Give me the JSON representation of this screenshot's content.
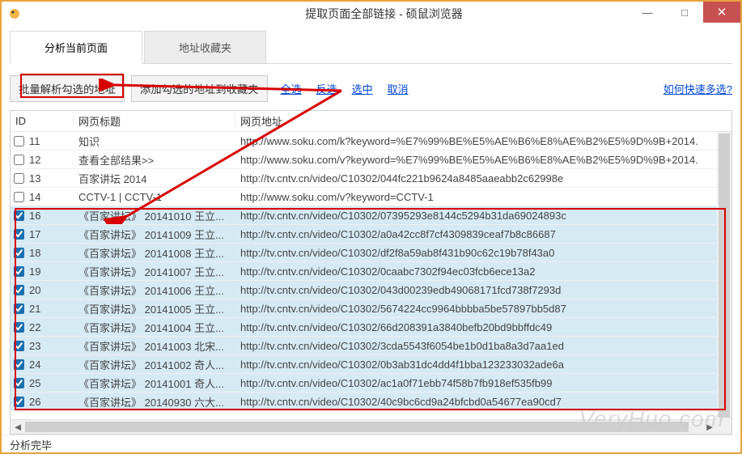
{
  "window": {
    "title": "提取页面全部链接 - 硕鼠浏览器"
  },
  "tabs": {
    "active": "分析当前页面",
    "inactive": "地址收藏夹"
  },
  "toolbar": {
    "batch": "批量解析勾选的地址",
    "add": "添加勾选的地址到收藏夹",
    "selectAll": "全选",
    "invert": "反选",
    "selectChecked": "选中",
    "cancel": "取消",
    "help": "如何快速多选?"
  },
  "columns": {
    "id": "ID",
    "title": "网页标题",
    "url": "网页地址"
  },
  "rows": [
    {
      "id": "11",
      "checked": false,
      "sel": false,
      "title": "知识",
      "url": "http://www.soku.com/k?keyword=%E7%99%BE%E5%AE%B6%E8%AE%B2%E5%9D%9B+2014."
    },
    {
      "id": "12",
      "checked": false,
      "sel": false,
      "title": "查看全部结果&gt;&gt;",
      "url": "http://www.soku.com/v?keyword=%E7%99%BE%E5%AE%B6%E8%AE%B2%E5%9D%9B+2014."
    },
    {
      "id": "13",
      "checked": false,
      "sel": false,
      "title": "百家讲坛 2014",
      "url": "http://tv.cntv.cn/video/C10302/044fc221b9624a8485aaeabb2c62998e"
    },
    {
      "id": "14",
      "checked": false,
      "sel": false,
      "title": "CCTV-1 | CCTV-1",
      "url": "http://www.soku.com/v?keyword=CCTV-1"
    },
    {
      "id": "16",
      "checked": true,
      "sel": true,
      "title": "《百家讲坛》 20141010 王立...",
      "url": "http://tv.cntv.cn/video/C10302/07395293e8144c5294b31da69024893c"
    },
    {
      "id": "17",
      "checked": true,
      "sel": true,
      "title": "《百家讲坛》 20141009 王立...",
      "url": "http://tv.cntv.cn/video/C10302/a0a42cc8f7cf4309839ceaf7b8c86687"
    },
    {
      "id": "18",
      "checked": true,
      "sel": true,
      "title": "《百家讲坛》 20141008 王立...",
      "url": "http://tv.cntv.cn/video/C10302/df2f8a59ab8f431b90c62c19b78f43a0"
    },
    {
      "id": "19",
      "checked": true,
      "sel": true,
      "title": "《百家讲坛》 20141007 王立...",
      "url": "http://tv.cntv.cn/video/C10302/0caabc7302f94ec03fcb6ece13a2"
    },
    {
      "id": "20",
      "checked": true,
      "sel": true,
      "title": "《百家讲坛》 20141006 王立...",
      "url": "http://tv.cntv.cn/video/C10302/043d00239edb49068171fcd738f7293d"
    },
    {
      "id": "21",
      "checked": true,
      "sel": true,
      "title": "《百家讲坛》 20141005 王立...",
      "url": "http://tv.cntv.cn/video/C10302/5674224cc9964bbbba5be57897bb5d87"
    },
    {
      "id": "22",
      "checked": true,
      "sel": true,
      "title": "《百家讲坛》 20141004 王立...",
      "url": "http://tv.cntv.cn/video/C10302/66d208391a3840befb20bd9bbffdc49"
    },
    {
      "id": "23",
      "checked": true,
      "sel": true,
      "title": "《百家讲坛》 20141003 北宋...",
      "url": "http://tv.cntv.cn/video/C10302/3cda5543f6054be1b0d1ba8a3d7aa1ed"
    },
    {
      "id": "24",
      "checked": true,
      "sel": true,
      "title": "《百家讲坛》 20141002 奇人...",
      "url": "http://tv.cntv.cn/video/C10302/0b3ab31dc4dd4f1bba123233032ade6a"
    },
    {
      "id": "25",
      "checked": true,
      "sel": true,
      "title": "《百家讲坛》 20141001 奇人...",
      "url": "http://tv.cntv.cn/video/C10302/ac1a0f71ebb74f58b7fb918ef535fb99"
    },
    {
      "id": "26",
      "checked": true,
      "sel": true,
      "title": "《百家讲坛》 20140930 六大...",
      "url": "http://tv.cntv.cn/video/C10302/40c9bc6cd9a24bfcbd0a54677ea90cd7"
    }
  ],
  "status": "分析完毕",
  "watermark": "VeryHuo.com"
}
